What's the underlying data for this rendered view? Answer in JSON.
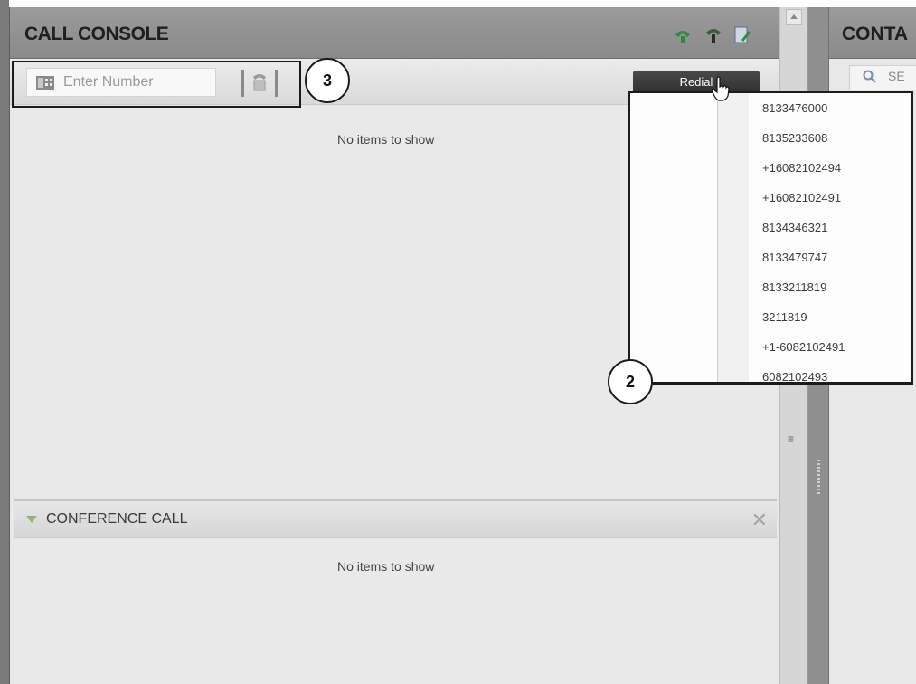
{
  "console": {
    "title": "CALL CONSOLE",
    "number_placeholder": "Enter Number",
    "empty_text": "No items to show"
  },
  "conference": {
    "title": "CONFERENCE CALL",
    "empty_text": "No items to show",
    "close_glyph": "✕"
  },
  "contacts": {
    "title": "CONTA",
    "search_text": "SE"
  },
  "redial": {
    "label": "Redial",
    "numbers": [
      "8133476000",
      "8135233608",
      "+16082102494",
      "+16082102491",
      "8134346321",
      "8133479747",
      "8133211819",
      "3211819",
      "+1-6082102491",
      "6082102493"
    ]
  },
  "callouts": {
    "two": "2",
    "three": "3"
  },
  "scrollbar": {
    "grip_glyph": "≡"
  },
  "icons": {
    "header": [
      "call-green-icon",
      "hangup-icon",
      "edit-contact-icon"
    ],
    "dialpad": "dialpad-icon",
    "call": "phone-call-icon",
    "search": "search-icon"
  },
  "colors": {
    "header_bg": "#8f8f8f",
    "panel_bg": "#e9e9e9",
    "accent_green": "#2e8b3a",
    "redial_button": "#3a3a3a"
  }
}
